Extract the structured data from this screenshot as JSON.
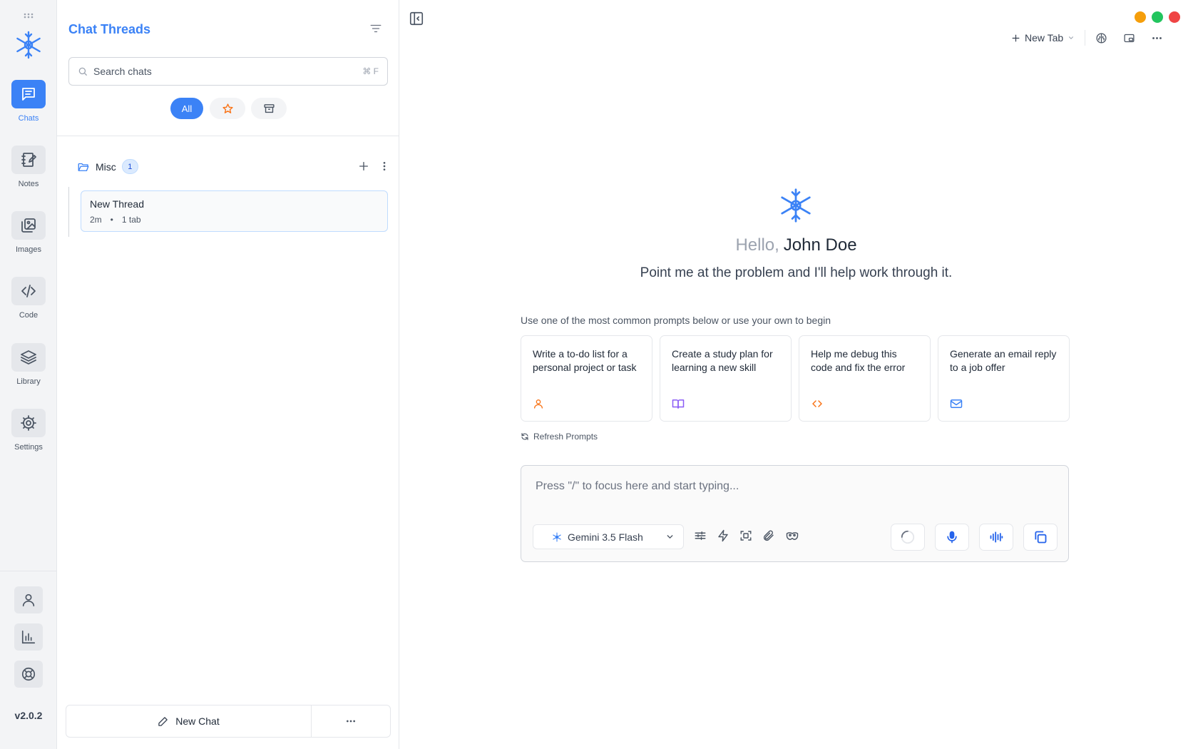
{
  "rail": {
    "items": [
      {
        "label": "Chats"
      },
      {
        "label": "Notes"
      },
      {
        "label": "Images"
      },
      {
        "label": "Code"
      },
      {
        "label": "Library"
      },
      {
        "label": "Settings"
      }
    ],
    "version": "v2.0.2"
  },
  "threads": {
    "title": "Chat Threads",
    "search_placeholder": "Search chats",
    "search_shortcut": "⌘ F",
    "filter_all": "All",
    "folder": {
      "name": "Misc",
      "count": "1"
    },
    "items": [
      {
        "title": "New Thread",
        "age": "2m",
        "separator": "•",
        "tabs": "1 tab"
      }
    ],
    "new_chat": "New Chat"
  },
  "main": {
    "new_tab": "New Tab",
    "greeting_hello": "Hello,",
    "user_name": "John Doe",
    "tagline": "Point me at the problem and I'll help work through it.",
    "prompt_hint": "Use one of the most common prompts below or use your own to begin",
    "cards": [
      {
        "text": "Write a to-do list for a personal project or task",
        "icon": "user-icon",
        "color": "#f97316"
      },
      {
        "text": "Create a study plan for learning a new skill",
        "icon": "book-icon",
        "color": "#8b5cf6"
      },
      {
        "text": "Help me debug this code and fix the error",
        "icon": "code-icon",
        "color": "#f97316"
      },
      {
        "text": "Generate an email reply to a job offer",
        "icon": "mail-icon",
        "color": "#3b82f6"
      }
    ],
    "refresh": "Refresh Prompts",
    "composer_placeholder": "Press \"/\" to focus here and start typing...",
    "model": "Gemini 3.5 Flash"
  },
  "colors": {
    "accent": "#3b82f6",
    "window_min": "#f59e0b",
    "window_max": "#22c55e",
    "window_close": "#ef4444"
  }
}
